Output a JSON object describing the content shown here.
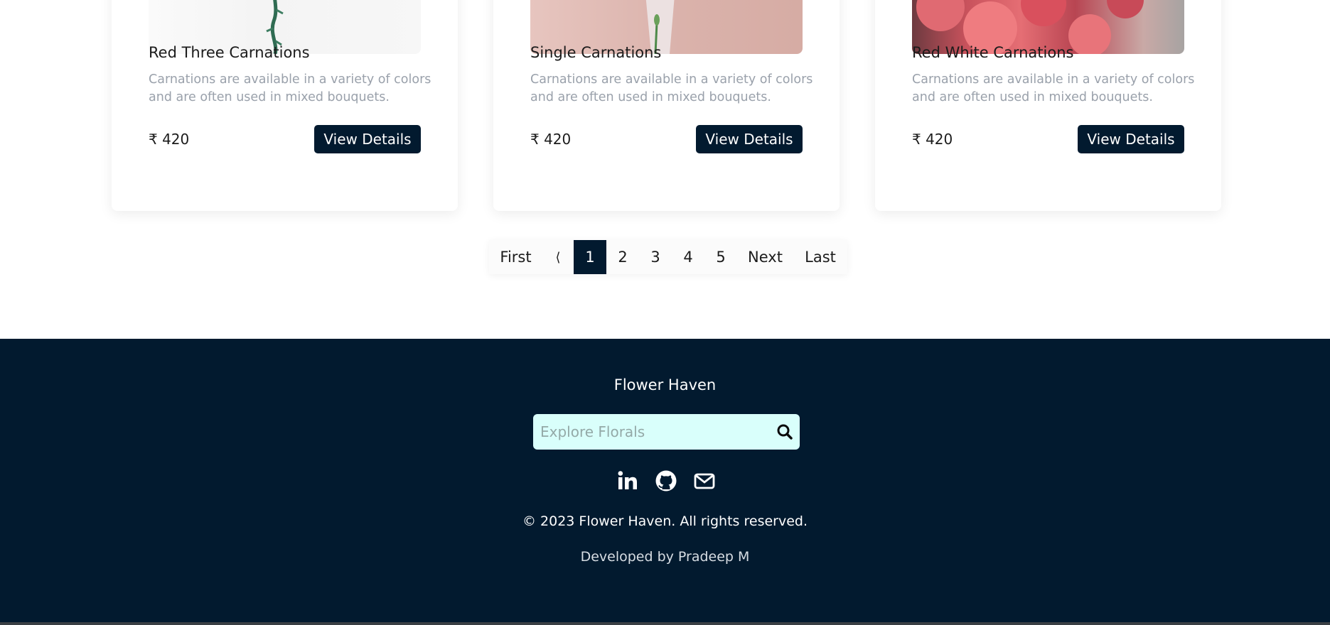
{
  "products": [
    {
      "title": "Red Three Carnations",
      "description": "Carnations are available in a variety of colors and are often used in mixed bouquets.",
      "price": "₹ 420",
      "button_label": "View Details",
      "image": "white-background-stem-photo"
    },
    {
      "title": "Single Carnations",
      "description": "Carnations are available in a variety of colors and are often used in mixed bouquets.",
      "price": "₹ 420",
      "button_label": "View Details",
      "image": "pink-background-vase-photo"
    },
    {
      "title": "Red White Carnations",
      "description": "Carnations are available in a variety of colors and are often used in mixed bouquets.",
      "price": "₹ 420",
      "button_label": "View Details",
      "image": "red-carnations-photo"
    }
  ],
  "pagination": {
    "first": "First",
    "prev": "⟨",
    "pages": [
      "1",
      "2",
      "3",
      "4",
      "5"
    ],
    "current": "1",
    "next": "Next",
    "last": "Last"
  },
  "footer": {
    "brand": "Flower Haven",
    "search": {
      "placeholder": "Explore Florals",
      "icon": "search-icon"
    },
    "socials": [
      "linkedin-icon",
      "github-icon",
      "email-icon"
    ],
    "copyright": "© 2023 Flower Haven. All rights reserved.",
    "credit": "Developed by Pradeep M"
  },
  "colors": {
    "primary": "#021a2f",
    "search_bg": "#d9fffb",
    "muted_text": "#9aa1ab"
  }
}
